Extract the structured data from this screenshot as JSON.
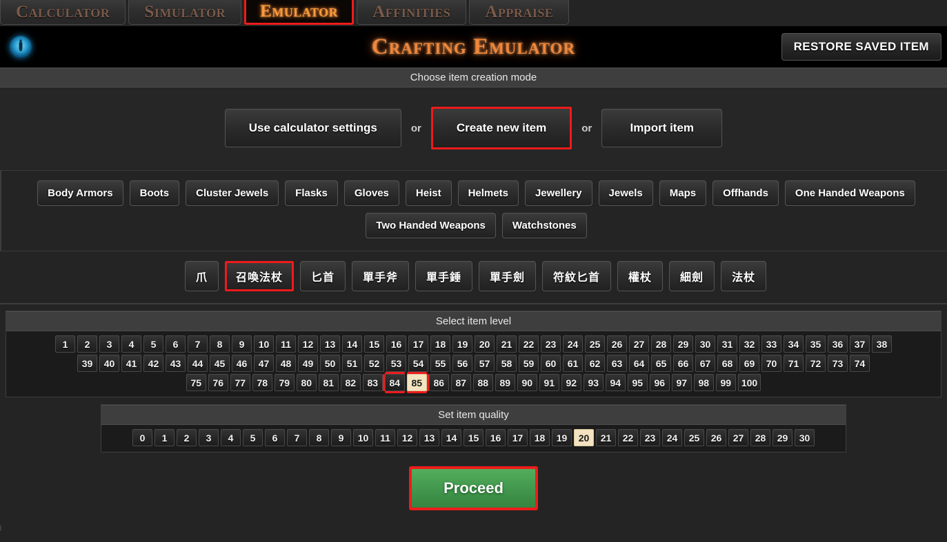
{
  "nav": {
    "tabs": [
      {
        "label": "Calculator",
        "active": false
      },
      {
        "label": "Simulator",
        "active": false
      },
      {
        "label": "Emulator",
        "active": true
      },
      {
        "label": "Affinities",
        "active": false
      },
      {
        "label": "Appraise",
        "active": false
      }
    ]
  },
  "header": {
    "title": "Crafting Emulator",
    "logo_icon": "poe-orb-icon",
    "restore_label": "RESTORE SAVED ITEM"
  },
  "mode": {
    "heading": "Choose item creation mode",
    "buttons": [
      {
        "label": "Use calculator settings",
        "highlight": false
      },
      {
        "label": "Create new item",
        "highlight": true
      },
      {
        "label": "Import item",
        "highlight": false
      }
    ],
    "separator": "or"
  },
  "categories": {
    "row1": [
      "Body Armors",
      "Boots",
      "Cluster Jewels",
      "Flasks",
      "Gloves",
      "Heist",
      "Helmets",
      "Jewellery",
      "Jewels",
      "Maps",
      "Offhands",
      "One Handed Weapons"
    ],
    "row2": [
      "Two Handed Weapons",
      "Watchstones"
    ]
  },
  "subtypes": {
    "items": [
      {
        "label": "爪",
        "selected": false
      },
      {
        "label": "召喚法杖",
        "selected": true
      },
      {
        "label": "匕首",
        "selected": false
      },
      {
        "label": "單手斧",
        "selected": false
      },
      {
        "label": "單手錘",
        "selected": false
      },
      {
        "label": "單手劍",
        "selected": false
      },
      {
        "label": "符紋匕首",
        "selected": false
      },
      {
        "label": "權杖",
        "selected": false
      },
      {
        "label": "細劍",
        "selected": false
      },
      {
        "label": "法杖",
        "selected": false
      }
    ]
  },
  "item_level": {
    "heading": "Select item level",
    "selected": 85,
    "box_start": 84,
    "box_end": 85,
    "rows": [
      [
        1,
        2,
        3,
        4,
        5,
        6,
        7,
        8,
        9,
        10,
        11,
        12,
        13,
        14,
        15,
        16,
        17,
        18,
        19,
        20,
        21,
        22,
        23,
        24,
        25,
        26,
        27,
        28,
        29,
        30,
        31,
        32,
        33,
        34,
        35,
        36,
        37,
        38
      ],
      [
        39,
        40,
        41,
        42,
        43,
        44,
        45,
        46,
        47,
        48,
        49,
        50,
        51,
        52,
        53,
        54,
        55,
        56,
        57,
        58,
        59,
        60,
        61,
        62,
        63,
        64,
        65,
        66,
        67,
        68,
        69,
        70,
        71,
        72,
        73,
        74
      ],
      [
        75,
        76,
        77,
        78,
        79,
        80,
        81,
        82,
        83,
        84,
        85,
        86,
        87,
        88,
        89,
        90,
        91,
        92,
        93,
        94,
        95,
        96,
        97,
        98,
        99,
        100
      ]
    ]
  },
  "item_quality": {
    "heading": "Set item quality",
    "selected": 20,
    "rows": [
      [
        0,
        1,
        2,
        3,
        4,
        5,
        6,
        7,
        8,
        9,
        10,
        11,
        12,
        13,
        14,
        15,
        16,
        17,
        18,
        19,
        20,
        21,
        22,
        23,
        24,
        25,
        26,
        27,
        28,
        29,
        30
      ]
    ]
  },
  "proceed": {
    "label": "Proceed"
  },
  "colors": {
    "accent_orange": "#f0873a",
    "highlight_red": "#ef1b1b",
    "selected_cream": "#f4e3bf",
    "proceed_green": "#41964c",
    "page_bg": "#242424"
  }
}
